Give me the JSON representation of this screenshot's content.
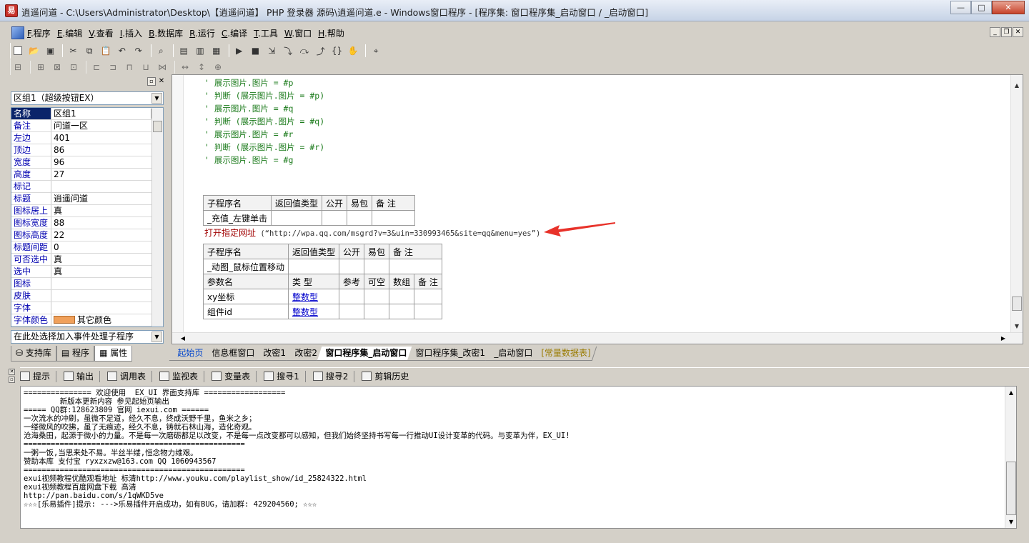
{
  "window": {
    "title": "逍遥问道 - C:\\Users\\Administrator\\Desktop\\【逍遥问道】 PHP 登录器 源码\\逍遥问道.e - Windows窗口程序 - [程序集: 窗口程序集_启动窗口 / _启动窗口]",
    "min": "—",
    "max": "□",
    "close": "✕"
  },
  "menu": {
    "items": [
      {
        "key": "F",
        "label": ".程序"
      },
      {
        "key": "E",
        "label": ".编辑"
      },
      {
        "key": "V",
        "label": ".查看"
      },
      {
        "key": "I",
        "label": ".插入"
      },
      {
        "key": "B",
        "label": ".数据库"
      },
      {
        "key": "R",
        "label": ".运行"
      },
      {
        "key": "C",
        "label": ".编译"
      },
      {
        "key": "T",
        "label": ".工具"
      },
      {
        "key": "W",
        "label": ".窗口"
      },
      {
        "key": "H",
        "label": ".帮助"
      }
    ]
  },
  "left_panel": {
    "selector": "区组1（超级按钮EX）",
    "event_selector": "在此处选择加入事件处理子程序",
    "properties": [
      {
        "name": "名称",
        "value": "区组1"
      },
      {
        "name": "备注",
        "value": "问道一区"
      },
      {
        "name": "左边",
        "value": "401"
      },
      {
        "name": "顶边",
        "value": "86"
      },
      {
        "name": "宽度",
        "value": "96"
      },
      {
        "name": "高度",
        "value": "27"
      },
      {
        "name": "标记",
        "value": ""
      },
      {
        "name": "标题",
        "value": "逍遥问道"
      },
      {
        "name": "图标居上",
        "value": "真"
      },
      {
        "name": "图标宽度",
        "value": "88"
      },
      {
        "name": "图标高度",
        "value": "22"
      },
      {
        "name": "标题间距",
        "value": "0"
      },
      {
        "name": "可否选中",
        "value": "真"
      },
      {
        "name": "选中",
        "value": "真"
      },
      {
        "name": "图标",
        "value": ""
      },
      {
        "name": "皮肤",
        "value": ""
      },
      {
        "name": "字体",
        "value": ""
      },
      {
        "name": "字体颜色",
        "value": "其它颜色"
      }
    ],
    "tabs": [
      "支持库",
      "程序",
      "属性"
    ]
  },
  "editor": {
    "code_lines": [
      "' 展示图片.图片 = #p",
      "' 判断 (展示图片.图片 = #p)",
      "' 展示图片.图片 = #q",
      "' 判断 (展示图片.图片 = #q)",
      "' 展示图片.图片 = #r",
      "' 判断 (展示图片.图片 = #r)",
      "' 展示图片.图片 = #g"
    ],
    "sub1": {
      "headers": [
        "子程序名",
        "返回值类型",
        "公开",
        "易包",
        "备 注"
      ],
      "name": "_充值_左键单击"
    },
    "call": {
      "func": "打开指定网址",
      "open": " (“",
      "url": "http://wpa.qq.com/msgrd?v=3&uin=330993465&site=qq&menu=yes",
      "close": "”)"
    },
    "sub2": {
      "headers": [
        "子程序名",
        "返回值类型",
        "公开",
        "易包",
        "备 注"
      ],
      "name": "_动图_鼠标位置移动",
      "param_headers": [
        "参数名",
        "类 型",
        "参考",
        "可空",
        "数组",
        "备 注"
      ],
      "params": [
        {
          "name": "xy坐标",
          "type": "整数型"
        },
        {
          "name": "组件id",
          "type": "整数型"
        }
      ]
    },
    "tabs": [
      "起始页",
      "信息框窗口",
      "改密1",
      "改密2",
      "窗口程序集_启动窗口",
      "窗口程序集_改密1",
      "_启动窗口",
      "[常量数据表]"
    ]
  },
  "bottom": {
    "tabs": [
      "提示",
      "输出",
      "调用表",
      "监视表",
      "变量表",
      "搜寻1",
      "搜寻2",
      "剪辑历史"
    ],
    "output_lines": [
      "=============== 欢迎使用  EX_UI 界面支持库 ==================",
      "        新版本更新内容 参见起始页输出",
      "===== QQ群:128623809 官网 iexui.com ======",
      "一次流水的冲刷，虽微不足道，经久不息，终成沃野千里，鱼米之乡；",
      "一缕微风的吹拂，虽了无痕迹，经久不息，铸就石林山海，造化奇观。",
      "沧海桑田，起源于微小的力量。不是每一次磨砺都足以改变，不是每一点改变都可以感知，但我们始终坚持书写每一行推动UI设计变革的代码。与变革为伴，EX_UI!",
      "=================================================",
      "一粥一饭,当思来处不易。半丝半缕,恒念物力维艰。",
      "赞助本库 支付宝 ryxzxzw@163.com QQ 1060943567",
      "=================================================",
      "exui视频教程优酷观看地址 标清http://www.youku.com/playlist_show/id_25824322.html",
      "exui视频教程百度网盘下载 高清",
      "http://pan.baidu.com/s/1qWKD5ve",
      "☆☆☆[乐易插件]提示: --->乐易插件开启成功，如有BUG，请加群: 429204560; ☆☆☆"
    ]
  },
  "colors": {
    "accent": "#0a246a",
    "swatch": "#f0a05a",
    "arrow": "#e8322a"
  }
}
